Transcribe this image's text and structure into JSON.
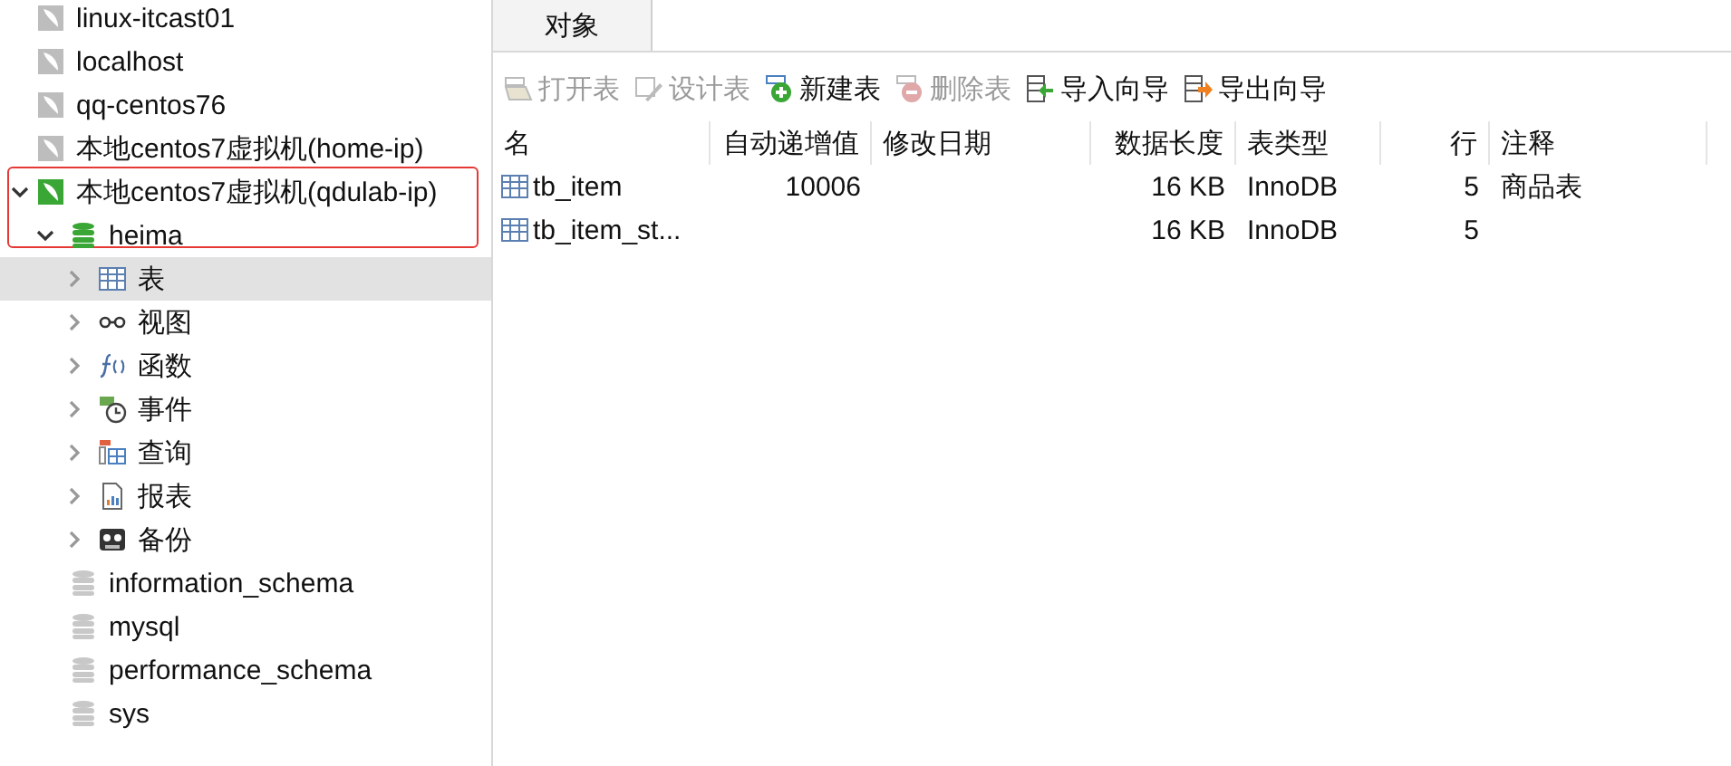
{
  "sidebar": {
    "items": [
      {
        "kind": "connection",
        "label": "linux-itcast01",
        "open": false
      },
      {
        "kind": "connection",
        "label": "localhost",
        "open": false
      },
      {
        "kind": "connection",
        "label": "qq-centos76",
        "open": false
      },
      {
        "kind": "connection",
        "label": "本地centos7虚拟机(home-ip)",
        "open": false
      },
      {
        "kind": "connection",
        "label": "本地centos7虚拟机(qdulab-ip)",
        "open": true,
        "highlighted": true,
        "expanded": true,
        "children": [
          {
            "kind": "database",
            "label": "heima",
            "open": true,
            "expanded": true,
            "children": [
              {
                "kind": "tables",
                "label": "表",
                "selected": true,
                "expanded": false
              },
              {
                "kind": "views",
                "label": "视图",
                "selected": false,
                "expanded": false
              },
              {
                "kind": "functions",
                "label": "函数",
                "selected": false,
                "expanded": false
              },
              {
                "kind": "events",
                "label": "事件",
                "selected": false,
                "expanded": false
              },
              {
                "kind": "queries",
                "label": "查询",
                "selected": false,
                "expanded": false
              },
              {
                "kind": "reports",
                "label": "报表",
                "selected": false,
                "expanded": false
              },
              {
                "kind": "backups",
                "label": "备份",
                "selected": false,
                "expanded": false
              }
            ]
          },
          {
            "kind": "database",
            "label": "information_schema",
            "open": false
          },
          {
            "kind": "database",
            "label": "mysql",
            "open": false
          },
          {
            "kind": "database",
            "label": "performance_schema",
            "open": false
          },
          {
            "kind": "database",
            "label": "sys",
            "open": false
          }
        ]
      }
    ]
  },
  "tabs": [
    {
      "label": "对象",
      "selected": true
    }
  ],
  "toolbar": [
    {
      "kind": "open",
      "label": "打开表",
      "disabled": true
    },
    {
      "kind": "design",
      "label": "设计表",
      "disabled": true
    },
    {
      "kind": "new",
      "label": "新建表",
      "disabled": false
    },
    {
      "kind": "delete",
      "label": "删除表",
      "disabled": true
    },
    {
      "kind": "import",
      "label": "导入向导",
      "disabled": false
    },
    {
      "kind": "export",
      "label": "导出向导",
      "disabled": false
    }
  ],
  "table": {
    "columns": [
      {
        "label": "名"
      },
      {
        "label": "自动递增值"
      },
      {
        "label": "修改日期"
      },
      {
        "label": "数据长度"
      },
      {
        "label": "表类型"
      },
      {
        "label": "行"
      },
      {
        "label": "注释"
      }
    ],
    "rows": [
      [
        "tb_item",
        "10006",
        "",
        "16 KB",
        "InnoDB",
        "5",
        "商品表"
      ],
      [
        "tb_item_st...",
        "",
        "",
        "16 KB",
        "InnoDB",
        "5",
        ""
      ]
    ]
  }
}
